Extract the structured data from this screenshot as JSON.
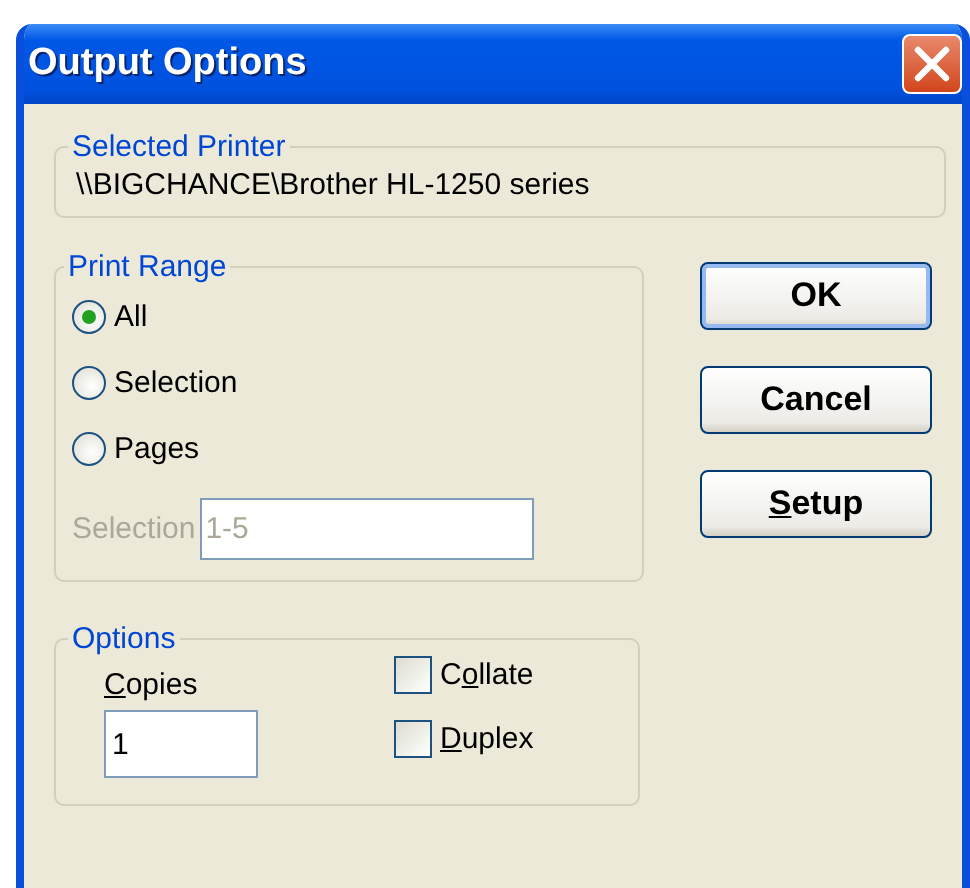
{
  "window": {
    "title": "Output Options"
  },
  "selected_printer": {
    "legend": "Selected Printer",
    "value": "\\\\BIGCHANCE\\Brother HL-1250 series"
  },
  "print_range": {
    "legend": "Print Range",
    "options": [
      {
        "label": "All",
        "selected": true
      },
      {
        "label": "Selection",
        "selected": false
      },
      {
        "label": "Pages",
        "selected": false
      }
    ],
    "selection_field": {
      "label": "Selection",
      "value": "1-5",
      "disabled": true
    }
  },
  "buttons": [
    {
      "label": "OK",
      "default": true
    },
    {
      "label": "Cancel",
      "default": false
    },
    {
      "key": "S",
      "rest": "etup",
      "default": false
    }
  ],
  "options": {
    "legend": "Options",
    "copies": {
      "key": "C",
      "rest": "opies",
      "value": "1"
    },
    "checkboxes": [
      {
        "lead": "C",
        "key": "o",
        "rest": "llate",
        "checked": false
      },
      {
        "key": "D",
        "rest": "uplex",
        "checked": false
      }
    ]
  }
}
